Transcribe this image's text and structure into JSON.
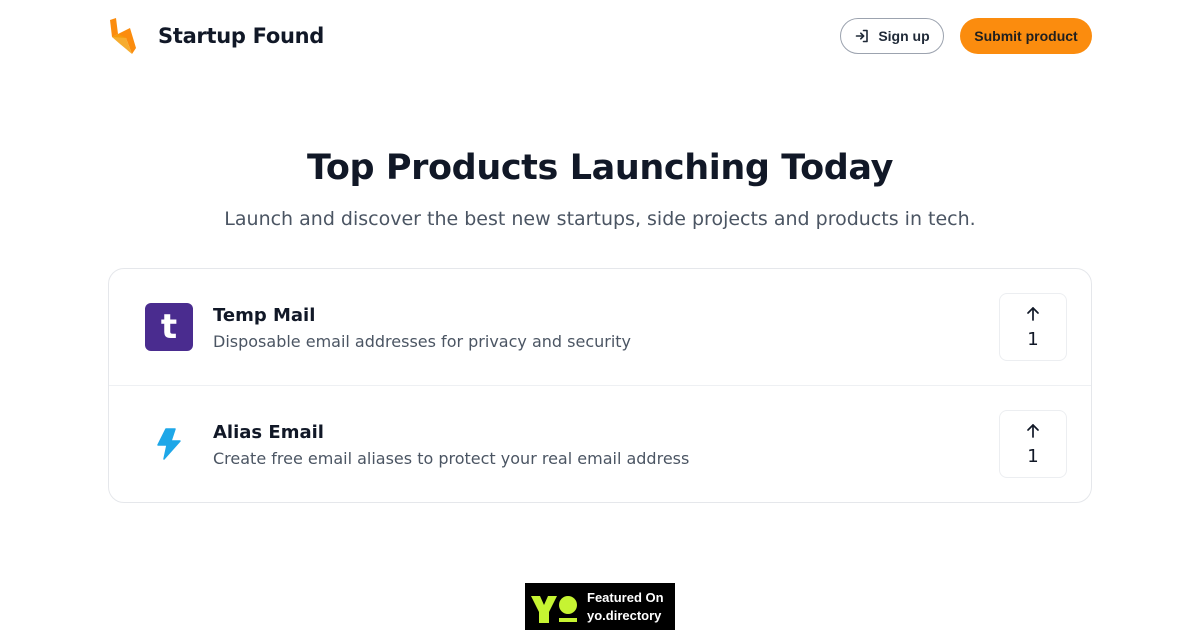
{
  "header": {
    "brand_name": "Startup Found",
    "signup_label": "Sign up",
    "submit_label": "Submit product",
    "accent_color": "#fb8c0e"
  },
  "hero": {
    "title": "Top Products Launching Today",
    "subtitle": "Launch and discover the best new startups, side projects and products in tech."
  },
  "products": [
    {
      "name": "Temp Mail",
      "description": "Disposable email addresses for privacy and security",
      "logo_letter": "t",
      "logo_color": "#4a2c8f",
      "upvotes": "1"
    },
    {
      "name": "Alias Email",
      "description": "Create free email aliases to protect your real email address",
      "logo_icon": "lightning-bolt-icon",
      "logo_color": "#1ea7e8",
      "upvotes": "1"
    }
  ],
  "badge": {
    "line1": "Featured On",
    "line2": "yo.directory",
    "logo_color": "#c6f432"
  },
  "icons": {
    "signup": "sign-in-arrow-icon",
    "upvote": "arrow-up-icon"
  }
}
